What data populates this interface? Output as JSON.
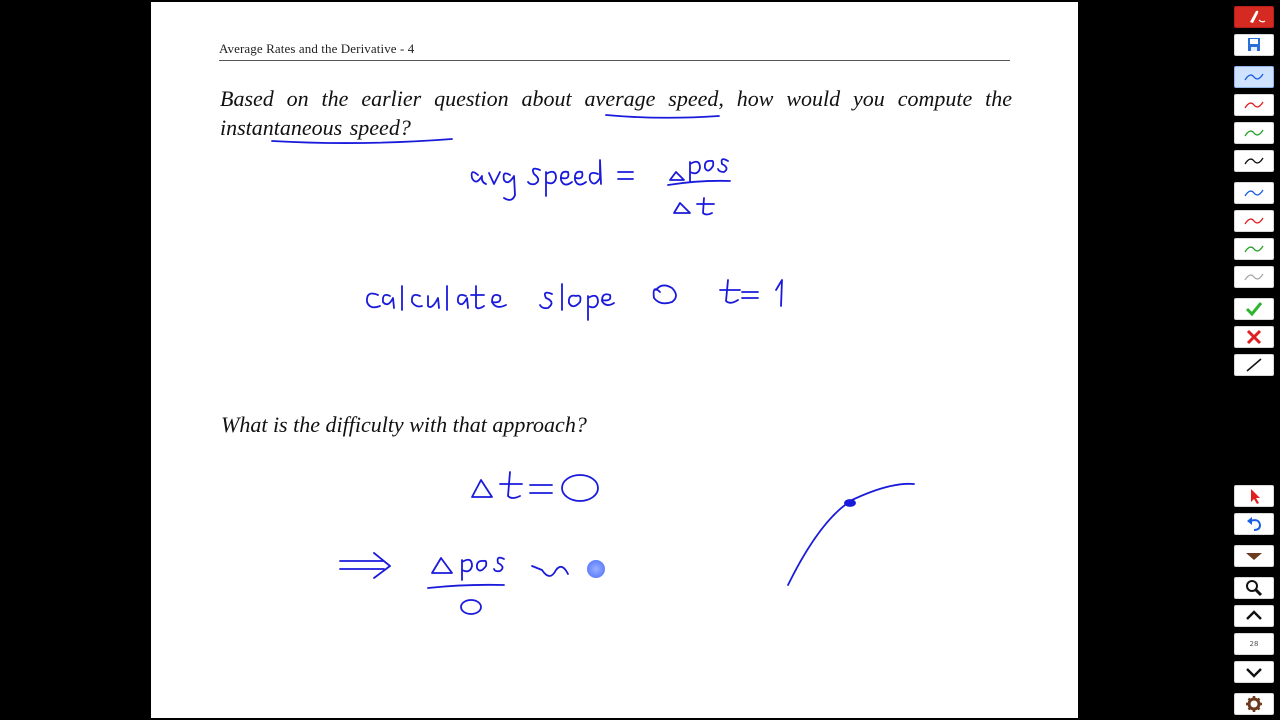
{
  "document": {
    "running_header": "Average Rates and the Derivative - 4",
    "question_1": "Based on the earlier question about average speed, how would you compute the instantaneous speed?",
    "question_2": "What is the difficulty with that approach?"
  },
  "toolbar": {
    "page_number": "28",
    "items": [
      {
        "name": "app-logo-icon"
      },
      {
        "name": "save-icon"
      },
      {
        "name": "pen-blue-thin-icon",
        "active": true
      },
      {
        "name": "pen-red-thin-icon"
      },
      {
        "name": "pen-green-thin-icon"
      },
      {
        "name": "pen-black-icon"
      },
      {
        "name": "highlighter-blue-icon"
      },
      {
        "name": "highlighter-red-icon"
      },
      {
        "name": "highlighter-green-icon"
      },
      {
        "name": "highlighter-gray-icon"
      },
      {
        "name": "check-mark-icon"
      },
      {
        "name": "cross-mark-icon"
      },
      {
        "name": "line-tool-icon"
      },
      {
        "name": "pointer-icon"
      },
      {
        "name": "undo-icon"
      },
      {
        "name": "dropdown-icon"
      },
      {
        "name": "search-icon"
      },
      {
        "name": "page-up-icon"
      },
      {
        "name": "page-down-icon"
      },
      {
        "name": "settings-gear-icon"
      }
    ]
  },
  "colors": {
    "ink_blue": "#1a1adb",
    "pen_red": "#e02020",
    "pen_green": "#2aa02a",
    "logo_red": "#d42a22",
    "active_tool": "#cfe2ff"
  }
}
